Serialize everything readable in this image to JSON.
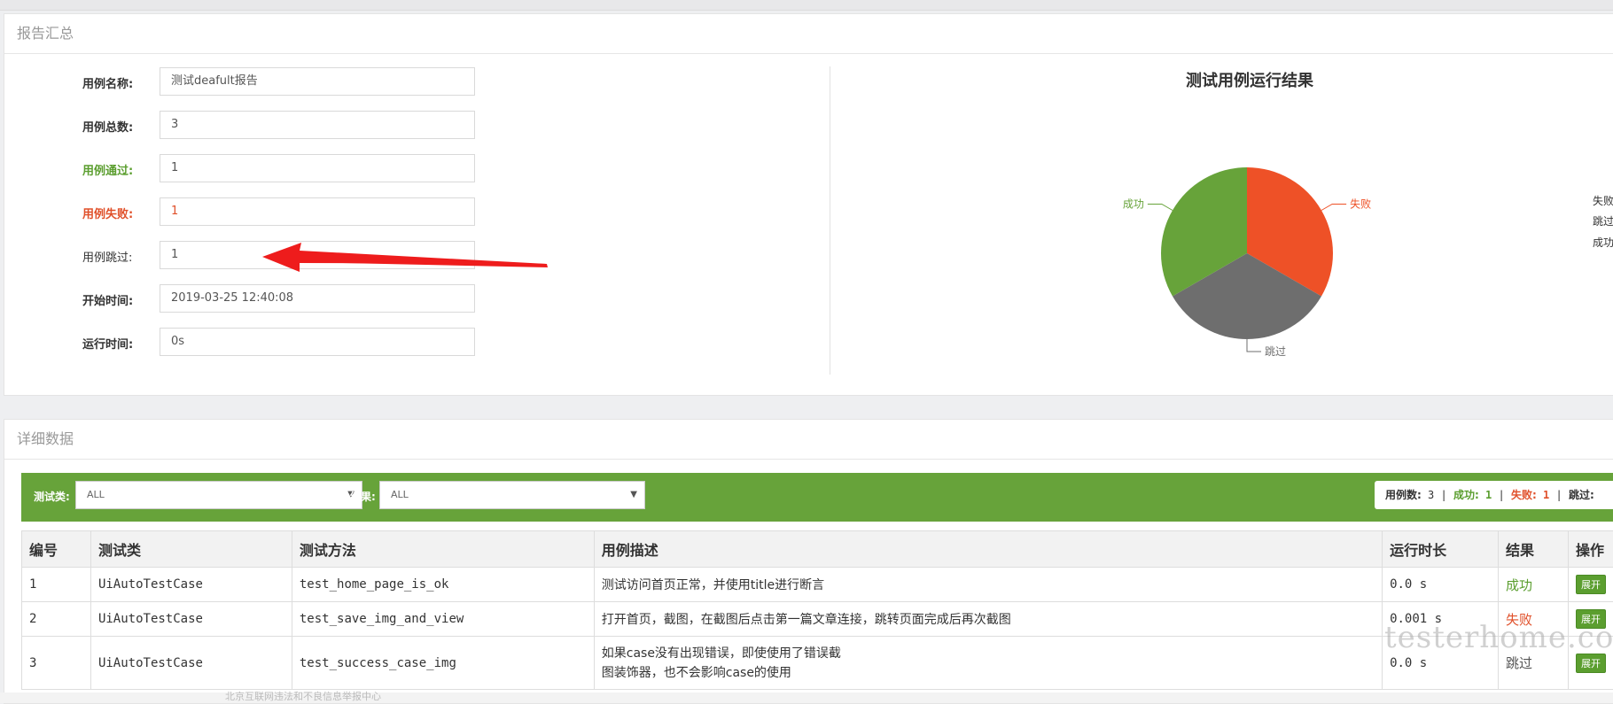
{
  "summary": {
    "title": "报告汇总",
    "fields": [
      {
        "label": "用例名称:",
        "value": "测试deafult报告"
      },
      {
        "label": "用例总数:",
        "value": "3"
      },
      {
        "label": "用例通过:",
        "value": "1"
      },
      {
        "label": "用例失败:",
        "value": "1"
      },
      {
        "label": "用例跳过:",
        "value": "1"
      },
      {
        "label": "开始时间:",
        "value": "2019-03-25 12:40:08"
      },
      {
        "label": "运行时间:",
        "value": "0s"
      }
    ]
  },
  "chart_data": {
    "type": "pie",
    "title": "测试用例运行结果",
    "slices": [
      {
        "label": "失败",
        "value": 1,
        "color": "#ee5127"
      },
      {
        "label": "跳过",
        "value": 1,
        "color": "#6e6e6e"
      },
      {
        "label": "成功",
        "value": 1,
        "color": "#67a33a"
      }
    ],
    "legend": [
      "失败",
      "跳过",
      "成功"
    ],
    "legend_position": "right"
  },
  "detail": {
    "title": "详细数据",
    "filter_class_label": "测试类:",
    "filter_class_value": "ALL",
    "filter_result_label": "结果:",
    "filter_result_value": "ALL",
    "counts": {
      "total_label": "用例数:",
      "total": "3",
      "pass_label": "成功:",
      "pass": "1",
      "fail_label": "失败:",
      "fail": "1",
      "skip_label": "跳过:",
      "sep": "|"
    },
    "columns": [
      "编号",
      "测试类",
      "测试方法",
      "用例描述",
      "运行时长",
      "结果",
      "操作"
    ],
    "rows": [
      {
        "id": "1",
        "cls": "UiAutoTestCase",
        "method": "test_home_page_is_ok",
        "desc1": "测试访问首页正常，并使用title进行断言",
        "desc2": "",
        "duration": "0.0 s",
        "result": "成功",
        "action": "展开"
      },
      {
        "id": "2",
        "cls": "UiAutoTestCase",
        "method": "test_save_img_and_view",
        "desc1": "打开首页，截图，在截图后点击第一篇文章连接，跳转页面完成后再次截图",
        "desc2": "",
        "duration": "0.001 s",
        "result": "失败",
        "action": "展开"
      },
      {
        "id": "3",
        "cls": "UiAutoTestCase",
        "method": "test_success_case_img",
        "desc1": "如果case没有出现错误，即使使用了错误截",
        "desc2": "图装饰器，也不会影响case的使用",
        "duration": "0.0 s",
        "result": "跳过",
        "action": "展开"
      }
    ]
  },
  "watermark": "testerhome.com",
  "footer_text": "北京互联网违法和不良信息举报中心",
  "colors": {
    "accent": "#67a33a",
    "fail": "#ee5127",
    "skip": "#6e6e6e"
  }
}
